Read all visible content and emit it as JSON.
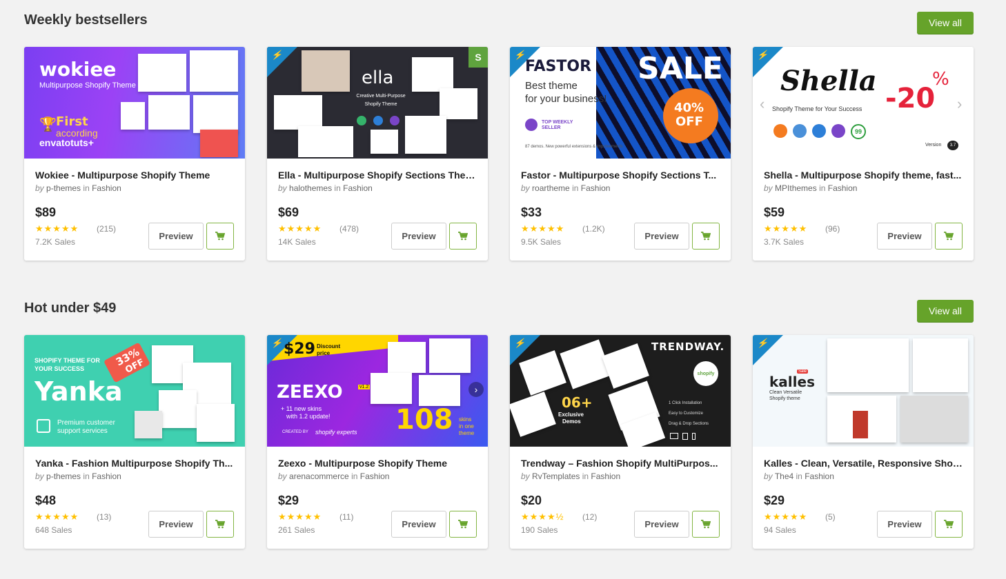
{
  "sections": [
    {
      "title": "Weekly bestsellers",
      "view_all": "View all",
      "items": [
        {
          "name": "Wokiee - Multipurpose Shopify Theme",
          "by": "by",
          "author": "p-themes",
          "in": "in",
          "category": "Fashion",
          "price": "$89",
          "stars": "★★★★★",
          "rating_count": "(215)",
          "sales": "7.2K Sales",
          "preview": "Preview",
          "thumb_text": [
            "wokiee",
            "Multipurpose Shopify Theme",
            "First",
            "according",
            "envatotuts+"
          ]
        },
        {
          "name": "Ella - Multipurpose Shopify Sections Theme",
          "by": "by",
          "author": "halothemes",
          "in": "in",
          "category": "Fashion",
          "price": "$69",
          "stars": "★★★★★",
          "rating_count": "(478)",
          "sales": "14K Sales",
          "preview": "Preview",
          "thumb_text": [
            "ella",
            "Creative Multi-Purpose",
            "Shopify Theme"
          ]
        },
        {
          "name": "Fastor - Multipurpose Shopify Sections T...",
          "by": "by",
          "author": "roartheme",
          "in": "in",
          "category": "Fashion",
          "price": "$33",
          "stars": "★★★★★",
          "rating_count": "(1.2K)",
          "sales": "9.5K Sales",
          "preview": "Preview",
          "thumb_text": [
            "FASTOR",
            "Best theme",
            "for your business!",
            "SALE",
            "40%",
            "OFF",
            "TOP WEEKLY",
            "SELLER",
            "87 demos. New powerful extensions & improvements"
          ]
        },
        {
          "name": "Shella - Multipurpose Shopify theme, fast...",
          "by": "by",
          "author": "MPIthemes",
          "in": "in",
          "category": "Fashion",
          "price": "$59",
          "stars": "★★★★★",
          "rating_count": "(96)",
          "sales": "3.7K Sales",
          "preview": "Preview",
          "thumb_text": [
            "Shella",
            "Shopify Theme for Your Success",
            "-20",
            "%",
            "Version",
            "3.7",
            "99"
          ]
        }
      ]
    },
    {
      "title": "Hot under $49",
      "view_all": "View all",
      "items": [
        {
          "name": "Yanka - Fashion Multipurpose Shopify Th...",
          "by": "by",
          "author": "p-themes",
          "in": "in",
          "category": "Fashion",
          "price": "$48",
          "stars": "★★★★★",
          "rating_count": "(13)",
          "sales": "648 Sales",
          "preview": "Preview",
          "thumb_text": [
            "SHOPIFY THEME FOR",
            "YOUR SUCCESS",
            "Yanka",
            "33%",
            "OFF",
            "Premium customer",
            "support services"
          ]
        },
        {
          "name": "Zeexo - Multipurpose Shopify Theme",
          "by": "by",
          "author": "arenacommerce",
          "in": "in",
          "category": "Fashion",
          "price": "$29",
          "stars": "★★★★★",
          "rating_count": "(11)",
          "sales": "261 Sales",
          "preview": "Preview",
          "thumb_text": [
            "$29",
            "Discount",
            "price",
            "ZEEXO",
            "v1.2",
            "+ 11 new skins",
            "with 1.2 update!",
            "108",
            "skins",
            "in one",
            "theme",
            "CREATED BY",
            "shopify experts"
          ]
        },
        {
          "name": "Trendway – Fashion Shopify MultiPurpos...",
          "by": "by",
          "author": "RvTemplates",
          "in": "in",
          "category": "Fashion",
          "price": "$20",
          "stars": "★★★★½",
          "rating_count": "(12)",
          "sales": "190 Sales",
          "preview": "Preview",
          "thumb_text": [
            "TRENDWAY.",
            "06+",
            "Exclusive",
            "Demos",
            "1 Click Installation",
            "Easy to Customize",
            "Drag & Drop Sections",
            "shopify"
          ]
        },
        {
          "name": "Kalles - Clean, Versatile, Responsive Shopi...",
          "by": "by",
          "author": "The4",
          "in": "in",
          "category": "Fashion",
          "price": "$29",
          "stars": "★★★★★",
          "rating_count": "(5)",
          "sales": "94 Sales",
          "preview": "Preview",
          "thumb_text": [
            "kalles",
            "Sale",
            "Clean Versatile",
            "Shopify theme"
          ]
        }
      ]
    }
  ],
  "colors": {
    "accent_green": "#66a32a",
    "star": "#ffc000",
    "badge_blue": "#1b88c8"
  },
  "icons": {
    "cart": "cart-icon",
    "badge": "lightning-bolt-icon"
  }
}
